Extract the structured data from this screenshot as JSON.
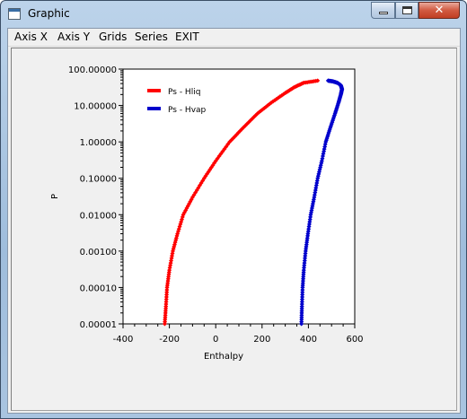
{
  "window": {
    "title": "Graphic",
    "icon": "app-window-icon",
    "close_glyph": "✕"
  },
  "menu": {
    "items": [
      "Axis X",
      "Axis Y",
      "Grids",
      "Series",
      "EXIT"
    ]
  },
  "chart_data": {
    "type": "scatter",
    "xlabel": "Enthalpy",
    "ylabel": "P",
    "xlim": [
      -400,
      600
    ],
    "ylim": [
      1e-05,
      100
    ],
    "yscale": "log",
    "x_ticks": [
      "-400",
      "-200",
      "0",
      "200",
      "400",
      "600"
    ],
    "y_ticks": [
      "0.00001",
      "0.00010",
      "0.00100",
      "0.01000",
      "0.10000",
      "1.00000",
      "10.00000",
      "100.00000"
    ],
    "grid": false,
    "legend_position": "top-left",
    "series": [
      {
        "name": "Ps - Hliq",
        "color": "#ff0000",
        "x": [
          -220,
          -215,
          -210,
          -200,
          -185,
          -165,
          -140,
          -100,
          -50,
          0,
          60,
          120,
          180,
          240,
          300,
          340,
          380,
          440
        ],
        "y": [
          1e-05,
          3e-05,
          0.0001,
          0.0003,
          0.001,
          0.003,
          0.01,
          0.03,
          0.1,
          0.3,
          1.0,
          2.5,
          6.0,
          12.0,
          22.0,
          32.0,
          42.0,
          48.0
        ]
      },
      {
        "name": "Ps - Hvap",
        "color": "#0000cc",
        "x": [
          370,
          372,
          375,
          380,
          388,
          398,
          410,
          425,
          440,
          458,
          475,
          495,
          515,
          530,
          540,
          545,
          540,
          525,
          505,
          485
        ],
        "y": [
          1e-05,
          3e-05,
          0.0001,
          0.0003,
          0.001,
          0.003,
          0.01,
          0.03,
          0.1,
          0.3,
          1.0,
          2.5,
          6.0,
          12.0,
          20.0,
          28.0,
          36.0,
          42.0,
          46.0,
          48.0
        ]
      }
    ]
  }
}
